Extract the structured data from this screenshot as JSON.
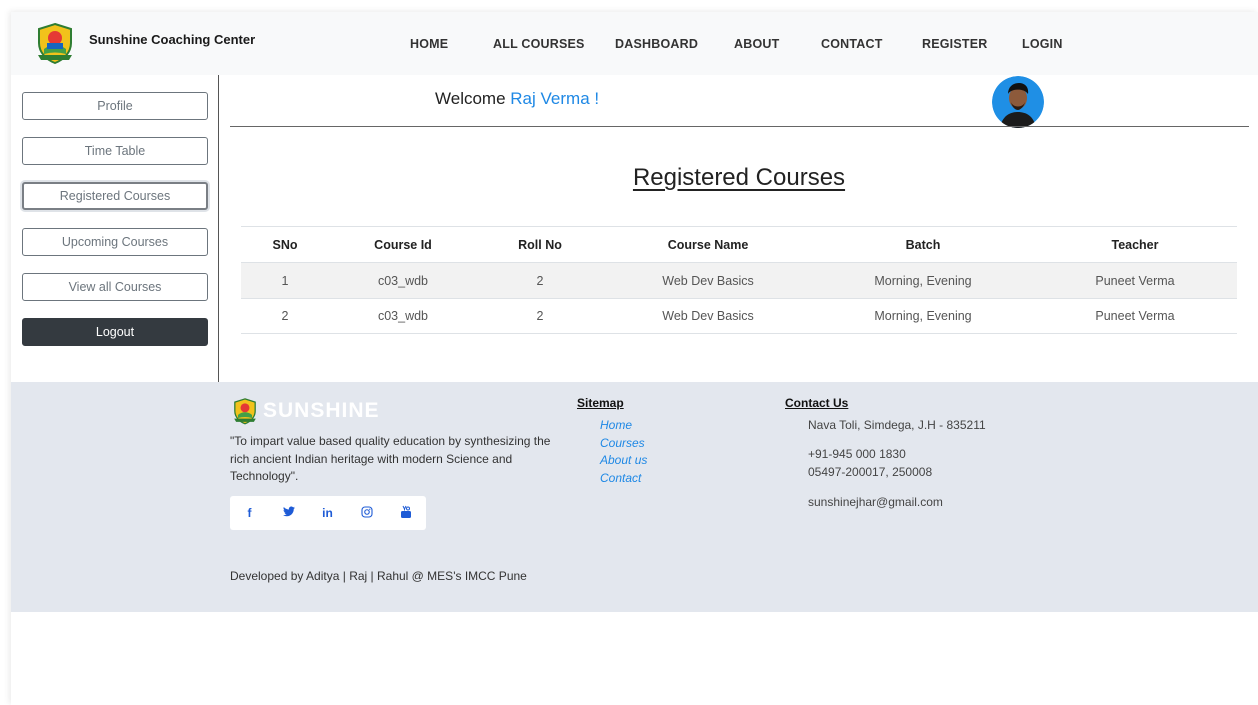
{
  "brand": {
    "name": "Sunshine Coaching Center"
  },
  "nav": {
    "home": "HOME",
    "all_courses": "ALL COURSES",
    "dashboard": "DASHBOARD",
    "about": "ABOUT",
    "contact": "CONTACT",
    "register": "REGISTER",
    "login": "LOGIN"
  },
  "sidebar": {
    "profile": "Profile",
    "time_table": "Time Table",
    "registered_courses": "Registered Courses",
    "upcoming_courses": "Upcoming Courses",
    "view_all_courses": "View all Courses",
    "logout": "Logout"
  },
  "welcome": {
    "prefix": "Welcome",
    "user": "Raj Verma !"
  },
  "section_title": "Registered Courses",
  "table": {
    "headers": [
      "SNo",
      "Course Id",
      "Roll No",
      "Course Name",
      "Batch",
      "Teacher"
    ],
    "rows": [
      [
        "1",
        "c03_wdb",
        "2",
        "Web Dev Basics",
        "Morning, Evening",
        "Puneet Verma"
      ],
      [
        "2",
        "c03_wdb",
        "2",
        "Web Dev Basics",
        "Morning, Evening",
        "Puneet Verma"
      ]
    ]
  },
  "footer": {
    "logo_text": "SUNSHINE",
    "quote": "\"To impart value based quality education by synthesizing the rich ancient Indian heritage with modern Science and Technology\".",
    "social": [
      "f",
      "✓",
      "in",
      "◎",
      "▤"
    ],
    "developed_by": "Developed by Aditya | Raj | Rahul @ MES's IMCC Pune",
    "sitemap": {
      "title": "Sitemap",
      "links": [
        "Home",
        "Courses",
        "About us",
        "Contact"
      ]
    },
    "contact": {
      "title": "Contact Us",
      "address": "Nava Toli, Simdega, J.H - 835211",
      "phone1": "+91-945 000 1830",
      "phone2": "05497-200017, 250008",
      "email": "sunshinejhar@gmail.com"
    }
  },
  "colors": {
    "accent": "#1e88e5",
    "logout_bg": "#343a40",
    "footer_bg": "#e3e7ee"
  }
}
